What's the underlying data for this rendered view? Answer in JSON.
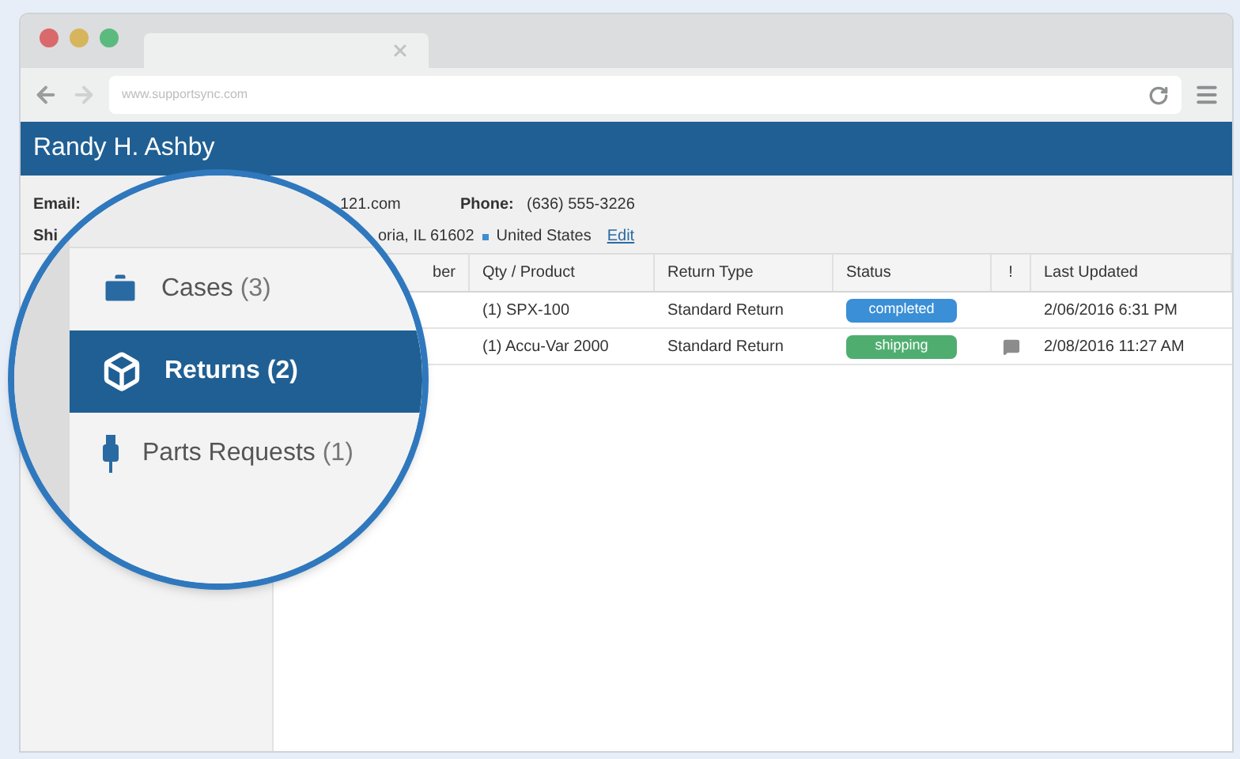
{
  "browser": {
    "url": "www.supportsync.com"
  },
  "header": {
    "name": "Randy H. Ashby"
  },
  "info": {
    "email_label": "Email:",
    "email_value": "121.com",
    "phone_label": "Phone:",
    "phone_value": "(636) 555-3226",
    "ship_label": "Shi",
    "address": "oria, IL 61602",
    "country": "United States",
    "edit_link": "Edit"
  },
  "table": {
    "columns": [
      "ber",
      "Qty / Product",
      "Return Type",
      "Status",
      "!",
      "Last Updated"
    ],
    "rows": [
      {
        "product": "(1) SPX-100",
        "return_type": "Standard Return",
        "status": "completed",
        "color": "#3a8fd6",
        "comment": false,
        "updated": "2/06/2016 6:31 PM"
      },
      {
        "product": "(1) Accu-Var 2000",
        "return_type": "Standard Return",
        "status": "shipping",
        "color": "#4fae6f",
        "comment": true,
        "updated": "2/08/2016 11:27 AM"
      }
    ]
  },
  "magnifier": {
    "items": [
      {
        "kind": "briefcase",
        "label": "Cases",
        "count": "(3)",
        "selected": false
      },
      {
        "kind": "box",
        "label": "Returns",
        "count": "(2)",
        "selected": true
      },
      {
        "kind": "plug",
        "label": "Parts Requests",
        "count": "(1)",
        "selected": false
      }
    ]
  }
}
